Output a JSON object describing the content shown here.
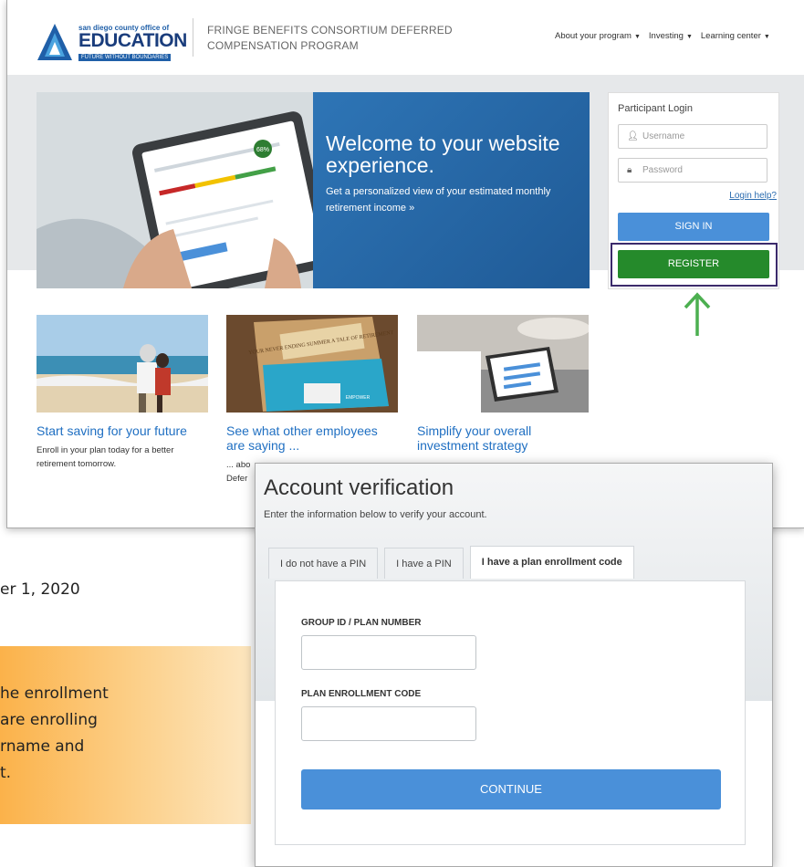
{
  "background_page": {
    "date_fragment": "er 1, 2020",
    "callout_lines": [
      "he enrollment",
      "are enrolling",
      "rname and",
      "t."
    ]
  },
  "site": {
    "logo": {
      "small_text": "san diego county office of",
      "big_text": "EDUCATION",
      "tagline": "FUTURE WITHOUT BOUNDARIES"
    },
    "header_title": "FRINGE BENEFITS CONSORTIUM DEFERRED COMPENSATION PROGRAM",
    "nav": {
      "about": "About your program",
      "investing": "Investing",
      "learning": "Learning center"
    },
    "hero": {
      "title": "Welcome to your website experience.",
      "subtitle": "Get a personalized view of your estimated monthly retirement income »",
      "device_badge": "68%"
    },
    "login": {
      "title": "Participant Login",
      "username_placeholder": "Username",
      "password_placeholder": "Password",
      "help_link": "Login help?",
      "signin_label": "SIGN IN",
      "register_label": "REGISTER"
    },
    "cards": [
      {
        "title": "Start saving for your future",
        "desc": "Enroll in your plan today for a better retirement tomorrow."
      },
      {
        "title": "See what other employees are saying ...",
        "desc": "... abo\nDefer"
      },
      {
        "title": "Simplify your overall investment strategy",
        "desc": ""
      }
    ],
    "book_text": "YOUR NEVER ENDING SUMMER A TALE OF RETIREMENT",
    "book_brand": "EMPOWER"
  },
  "modal": {
    "title": "Account verification",
    "subtitle": "Enter the information below to verify your account.",
    "tabs": [
      "I do not have a PIN",
      "I have a PIN",
      "I have a plan enrollment code"
    ],
    "active_tab_index": 2,
    "fields": {
      "group_id_label": "GROUP ID / PLAN NUMBER",
      "group_id_value": "",
      "enrollment_code_label": "PLAN ENROLLMENT CODE",
      "enrollment_code_value": ""
    },
    "continue_label": "CONTINUE"
  },
  "colors": {
    "brand_blue": "#1a3d7c",
    "hero_blue": "#2e75b6",
    "signin_blue": "#4a90d9",
    "register_green": "#258a2b",
    "highlight_outline": "#3b2a6b",
    "arrow_green": "#4caf50",
    "link_blue": "#1f6fc2",
    "callout_orange": "#fbb24a"
  }
}
